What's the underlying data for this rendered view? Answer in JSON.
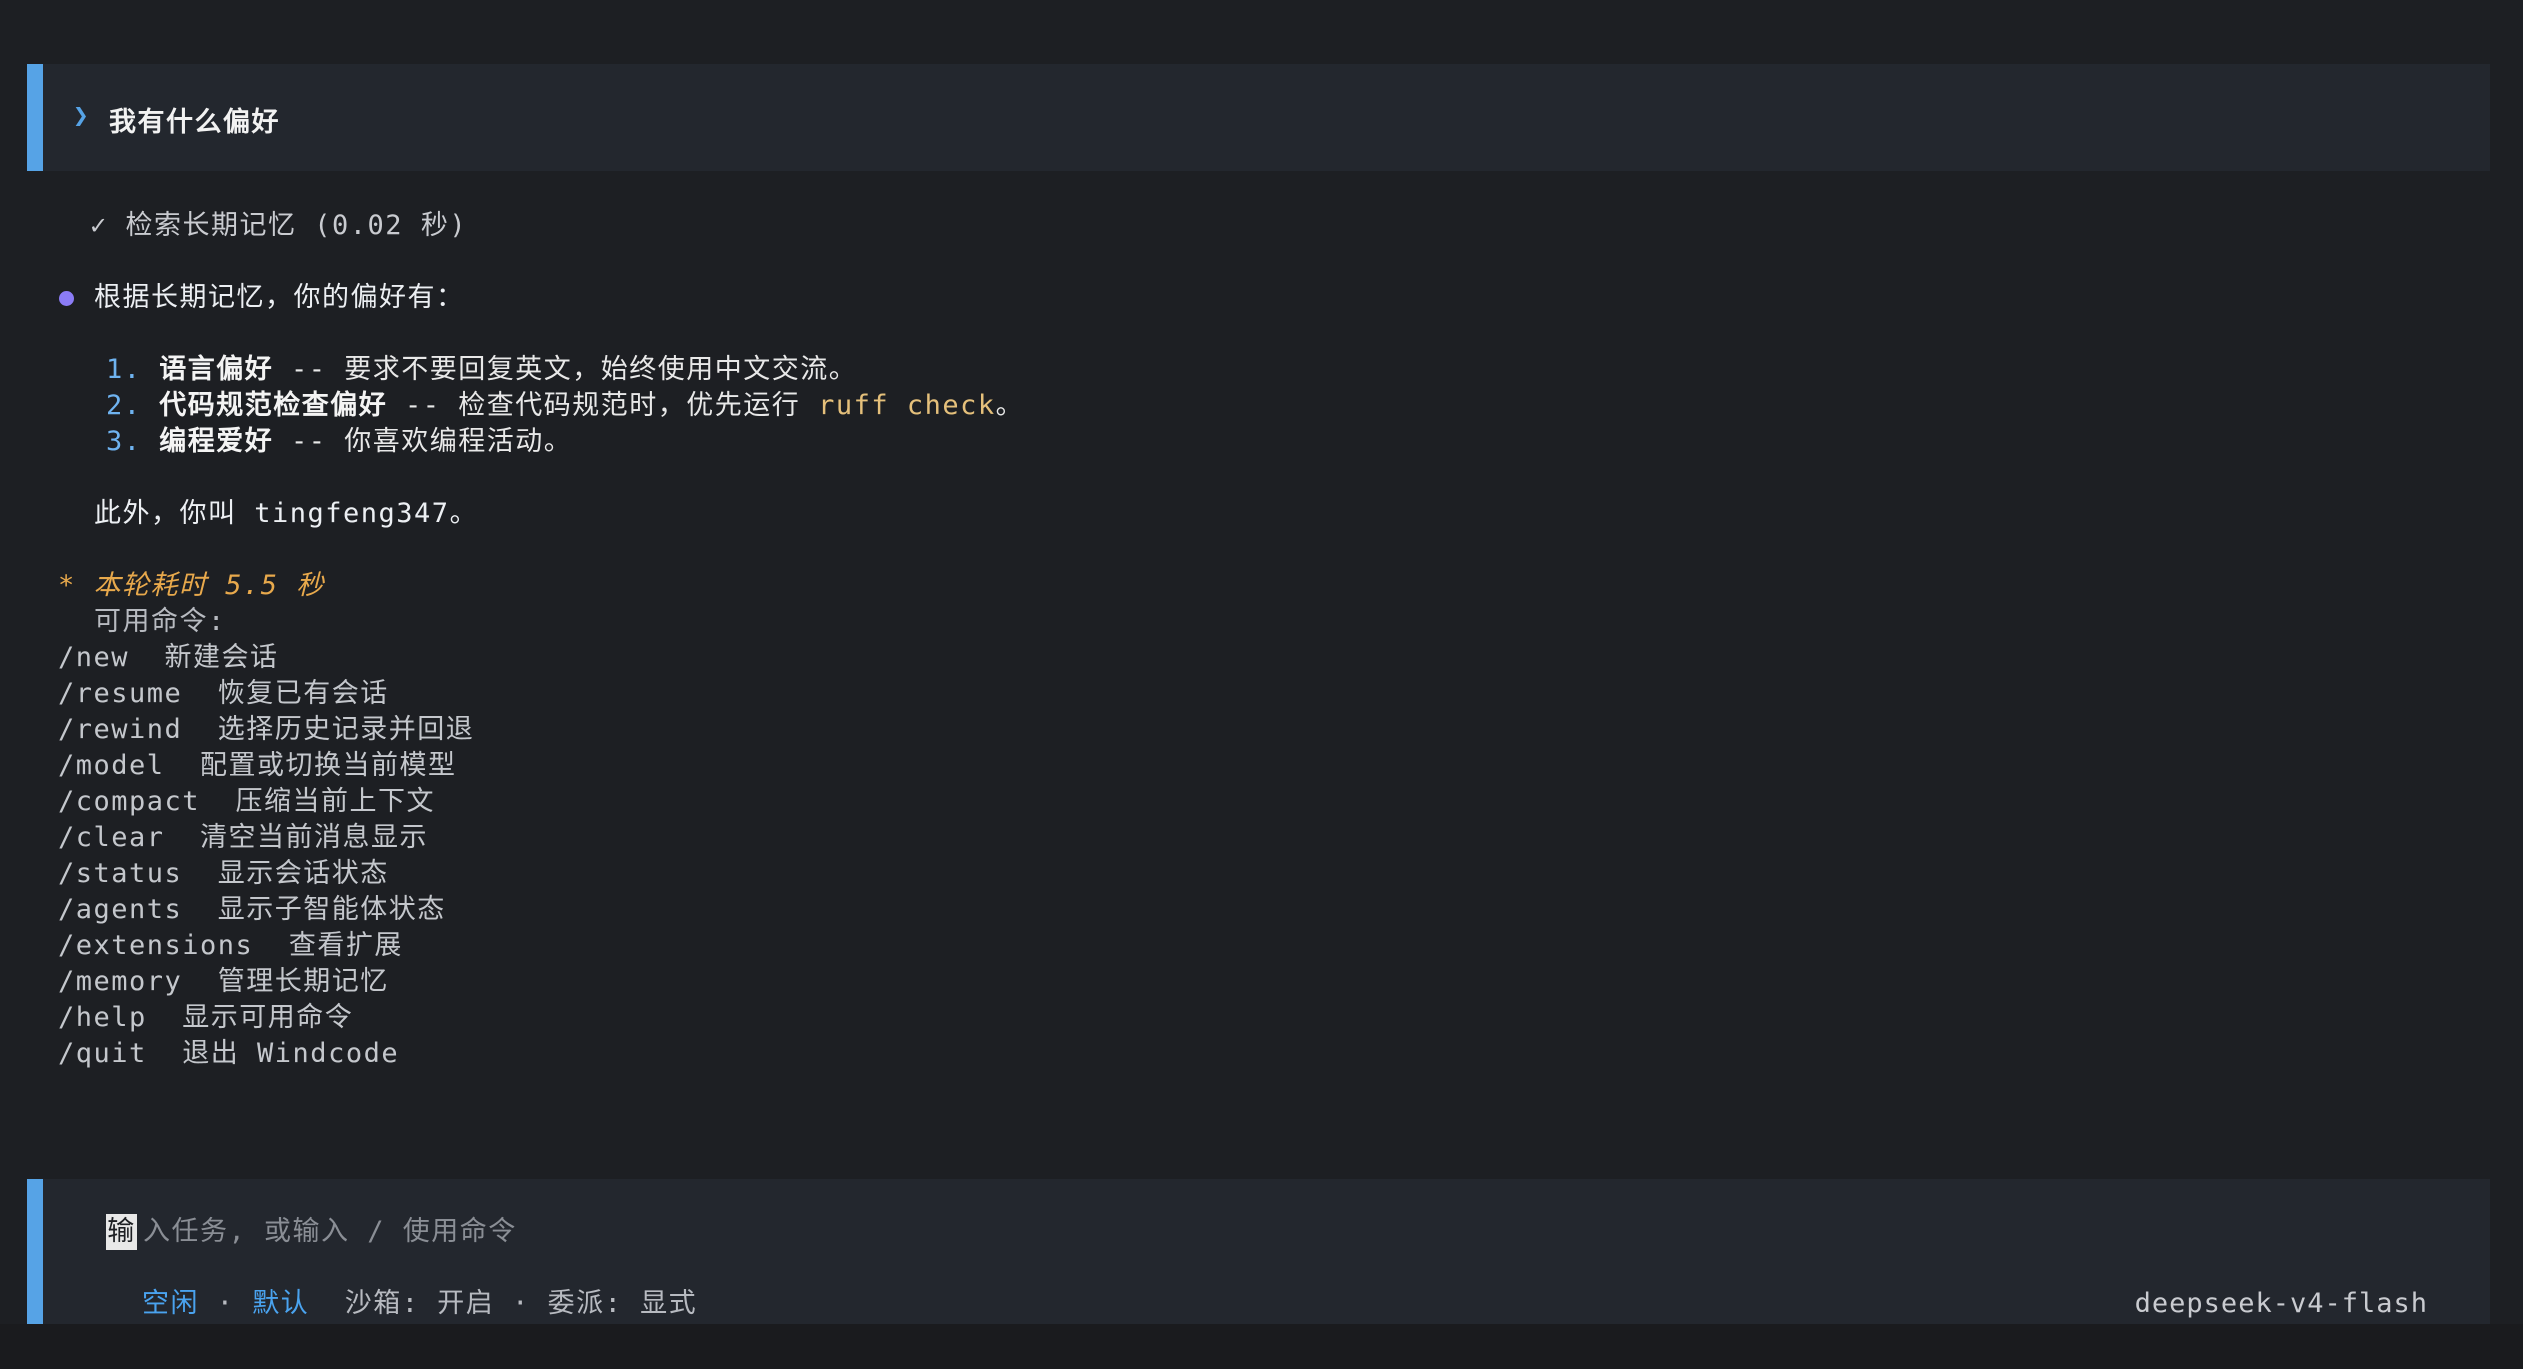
{
  "colors": {
    "accent": "#56a3e6",
    "bullet": "#8b7cf6",
    "timing": "#e8a94c",
    "status_active": "#4aa3ef"
  },
  "user_prompt": {
    "chevron": "❯",
    "chevron_icon": "chevron-right-icon",
    "text": "我有什么偏好"
  },
  "tool_call": {
    "check": "✓",
    "check_icon": "check-icon",
    "text": "检索长期记忆 (0.02 秒)"
  },
  "response": {
    "bullet_icon": "dot-icon",
    "intro": "根据长期记忆，你的偏好有：",
    "items": [
      {
        "num": "1.",
        "title": "语言偏好",
        "text": " -- 要求不要回复英文，始终使用中文交流。",
        "code": "",
        "suffix": ""
      },
      {
        "num": "2.",
        "title": "代码规范检查偏好",
        "text": " -- 检查代码规范时，优先运行 ",
        "code": "ruff check",
        "suffix": "。"
      },
      {
        "num": "3.",
        "title": "编程爱好",
        "text": " -- 你喜欢编程活动。",
        "code": "",
        "suffix": ""
      }
    ],
    "also": "此外，你叫 tingfeng347。"
  },
  "timing": "* 本轮耗时 5.5 秒",
  "commands": {
    "header": "可用命令:",
    "items": [
      "/new  新建会话",
      "/resume  恢复已有会话",
      "/rewind  选择历史记录并回退",
      "/model  配置或切换当前模型",
      "/compact  压缩当前上下文",
      "/clear  清空当前消息显示",
      "/status  显示会话状态",
      "/agents  显示子智能体状态",
      "/extensions  查看扩展",
      "/memory  管理长期记忆",
      "/help  显示可用命令",
      "/quit  退出 Windcode"
    ]
  },
  "input": {
    "cursor_char": "输",
    "placeholder_rest": "入任务, 或输入 / 使用命令"
  },
  "status_bar": {
    "state": "空闲",
    "sep1": " · ",
    "mode": "默认",
    "sandbox": "  沙箱: 开启",
    "sep2": " · ",
    "delegate": "委派: 显式",
    "model": "deepseek-v4-flash"
  }
}
